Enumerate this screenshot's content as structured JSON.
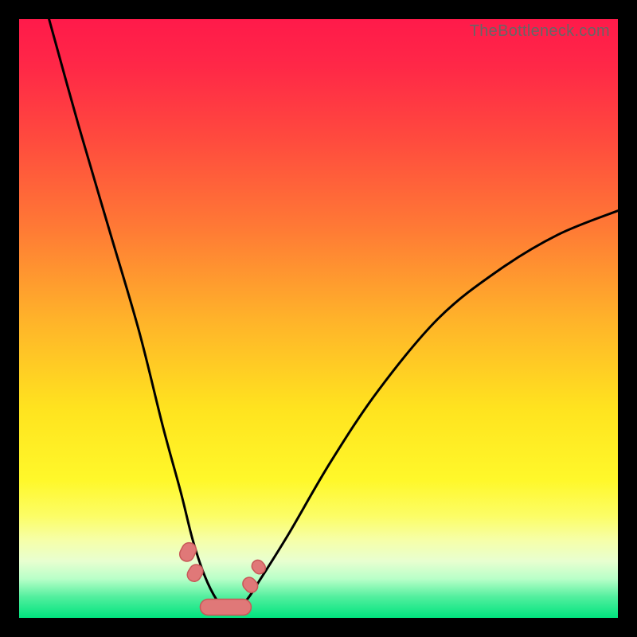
{
  "watermark": "TheBottleneck.com",
  "colors": {
    "gradient_stops": [
      {
        "offset": 0.0,
        "color": "#ff1a4a"
      },
      {
        "offset": 0.08,
        "color": "#ff2847"
      },
      {
        "offset": 0.2,
        "color": "#ff4a3e"
      },
      {
        "offset": 0.35,
        "color": "#ff7a35"
      },
      {
        "offset": 0.5,
        "color": "#ffb22a"
      },
      {
        "offset": 0.65,
        "color": "#ffe31f"
      },
      {
        "offset": 0.77,
        "color": "#fff82a"
      },
      {
        "offset": 0.83,
        "color": "#fcfd66"
      },
      {
        "offset": 0.87,
        "color": "#f6ffa8"
      },
      {
        "offset": 0.905,
        "color": "#e8ffd0"
      },
      {
        "offset": 0.935,
        "color": "#b8ffc8"
      },
      {
        "offset": 0.965,
        "color": "#52ef9e"
      },
      {
        "offset": 1.0,
        "color": "#00e37e"
      }
    ],
    "curve": "#000000",
    "blob_fill": "#e07878",
    "blob_stroke": "#c85858"
  },
  "chart_data": {
    "type": "line",
    "title": "",
    "xlabel": "",
    "ylabel": "",
    "xlim": [
      0,
      100
    ],
    "ylim": [
      0,
      100
    ],
    "series": [
      {
        "name": "bottleneck-curve",
        "x": [
          5,
          10,
          15,
          20,
          24,
          27,
          29,
          31,
          33,
          34.5,
          36,
          38,
          40,
          45,
          52,
          60,
          70,
          80,
          90,
          100
        ],
        "y": [
          100,
          82,
          65,
          48,
          32,
          21,
          13,
          7,
          3,
          1.5,
          1.5,
          3,
          6,
          14,
          26,
          38,
          50,
          58,
          64,
          68
        ]
      }
    ],
    "annotations": [
      {
        "name": "floor-blobs",
        "shape": "capsule_cluster",
        "approx_x_range": [
          28,
          40
        ],
        "approx_y_range": [
          0,
          12
        ]
      }
    ]
  }
}
